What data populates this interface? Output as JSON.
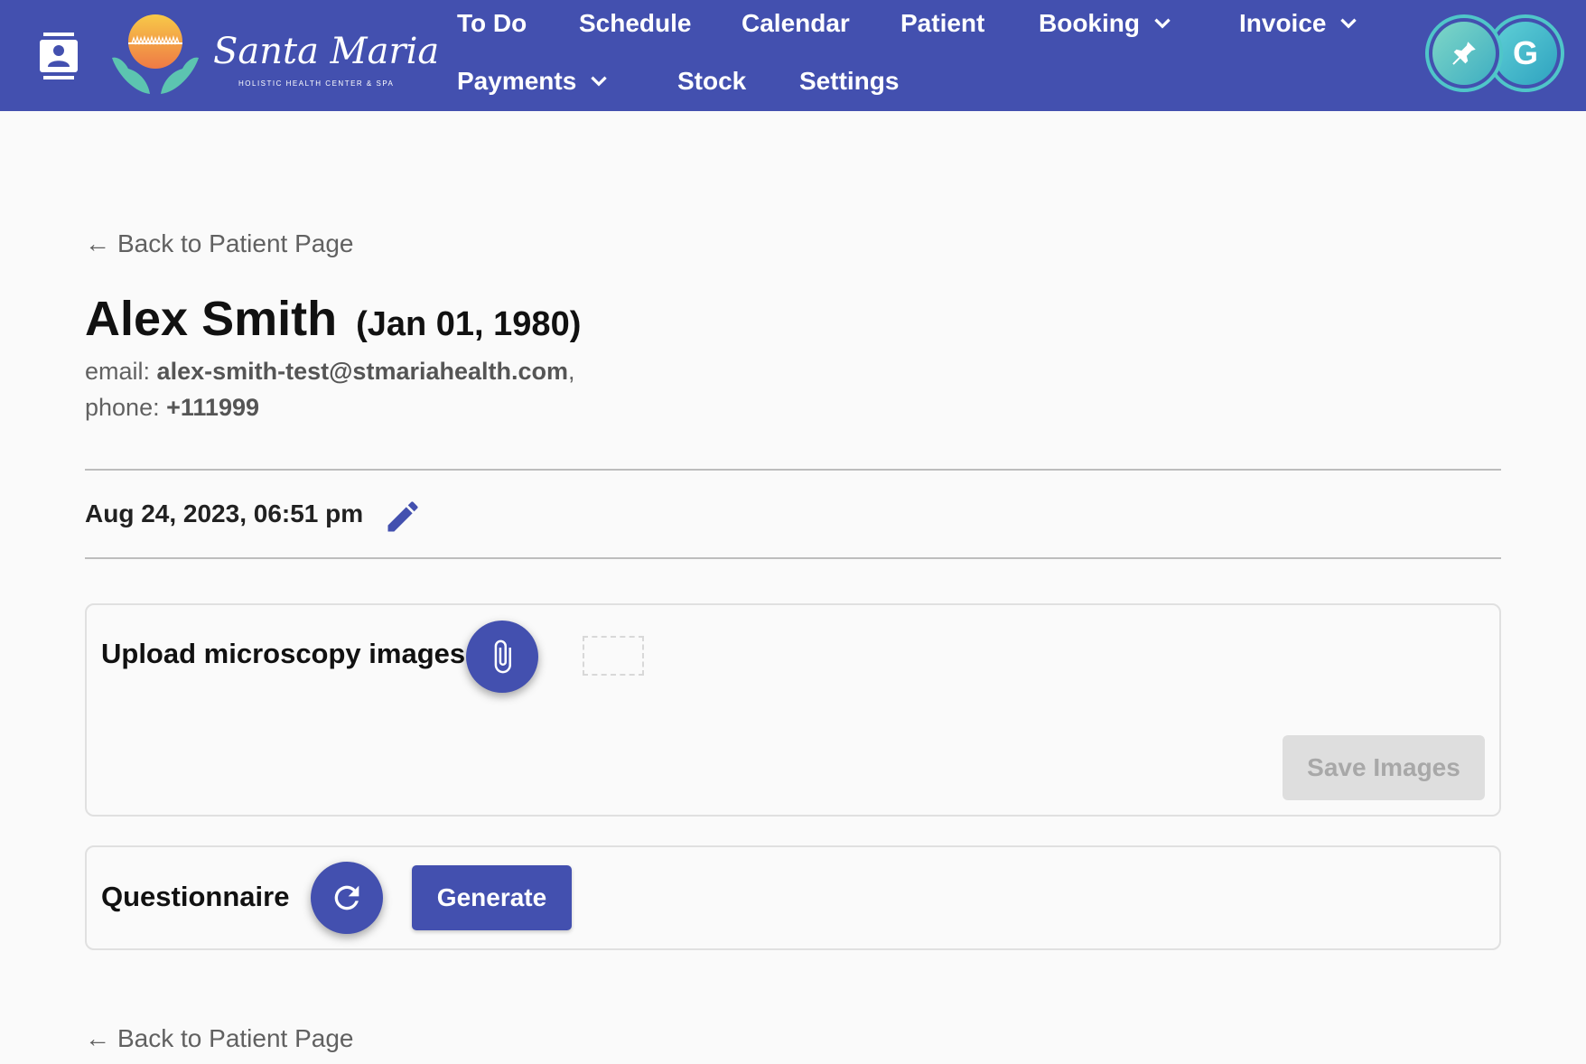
{
  "header": {
    "logo": {
      "name": "Santa Maria",
      "tagline": "HOLISTIC HEALTH CENTER & SPA"
    },
    "nav": [
      {
        "label": "To Do"
      },
      {
        "label": "Schedule"
      },
      {
        "label": "Calendar"
      },
      {
        "label": "Patient"
      },
      {
        "label": "Booking",
        "dropdown": true
      },
      {
        "label": "Invoice",
        "dropdown": true
      },
      {
        "label": "Payments",
        "dropdown": true
      },
      {
        "label": "Stock"
      },
      {
        "label": "Settings"
      }
    ],
    "avatars": {
      "pin_icon": "pin-icon",
      "user_initial": "G"
    }
  },
  "back_link": {
    "label": "Back to Patient Page"
  },
  "patient": {
    "name": "Alex Smith",
    "dob": "(Jan 01, 1980)",
    "email_label": "email:",
    "email": "alex-smith-test@stmariahealth.com",
    "email_suffix": ",",
    "phone_label": "phone:",
    "phone": "+111999"
  },
  "visit": {
    "datetime": "Aug 24, 2023, 06:51 pm",
    "edit_icon": "pencil-icon"
  },
  "upload_card": {
    "title": "Upload microscopy images",
    "attach_icon": "paperclip-icon",
    "save_label": "Save Images",
    "save_disabled": true
  },
  "questionnaire_card": {
    "title": "Questionnaire",
    "refresh_icon": "refresh-icon",
    "generate_label": "Generate"
  },
  "colors": {
    "primary": "#4350af",
    "accent": "#4fc6c9",
    "background": "#fafafa",
    "disabled": "#dedede"
  }
}
